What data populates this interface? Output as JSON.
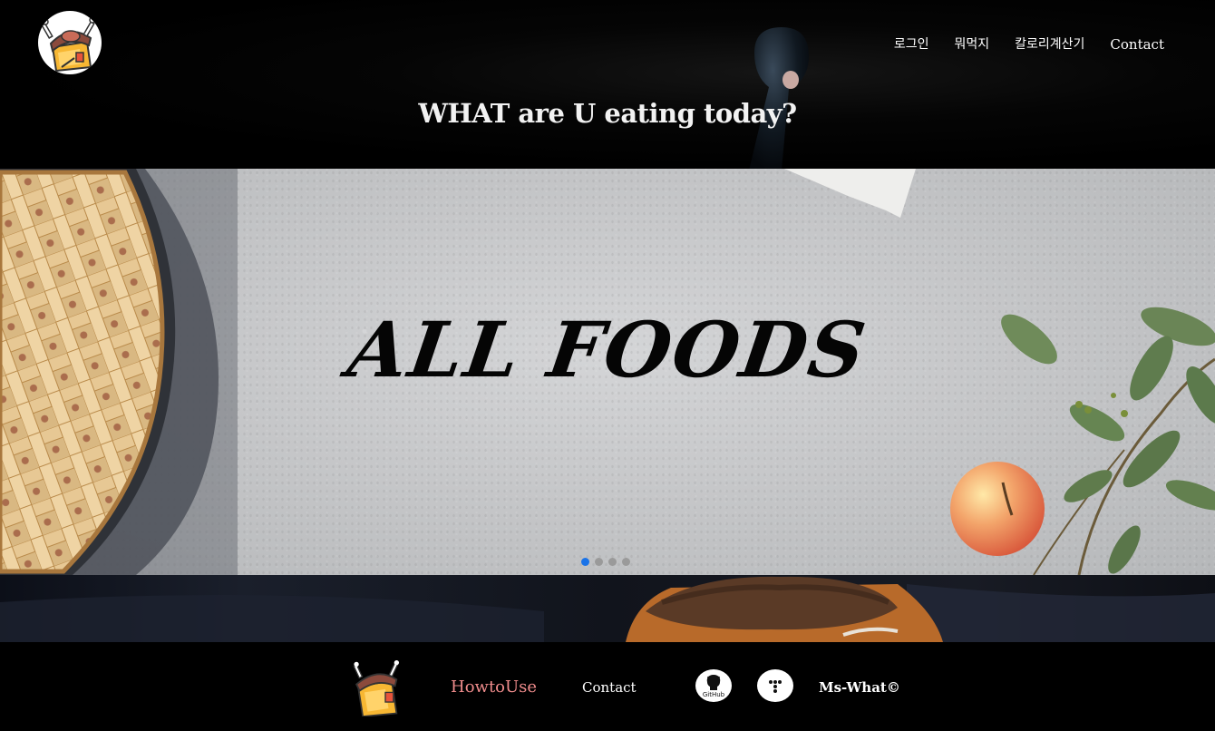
{
  "header": {
    "nav": [
      {
        "label": "로그인"
      },
      {
        "label": "뭐먹지"
      },
      {
        "label": "칼로리계산기"
      },
      {
        "label": "Contact"
      }
    ],
    "tagline": "WHAT are U eating today?"
  },
  "hero": {
    "title": "ALL FOODS",
    "slides_count": 4,
    "active_slide": 1,
    "active_dot_color": "#1a73e8"
  },
  "footer": {
    "howto_label": "HowtoUse",
    "contact_label": "Contact",
    "github_label": "GitHub",
    "copyright": "Ms-What©",
    "howto_color": "#f08c8c"
  },
  "icons": {
    "logo": "food-box-logo-icon",
    "github": "github-icon",
    "tistory": "tistory-icon"
  }
}
